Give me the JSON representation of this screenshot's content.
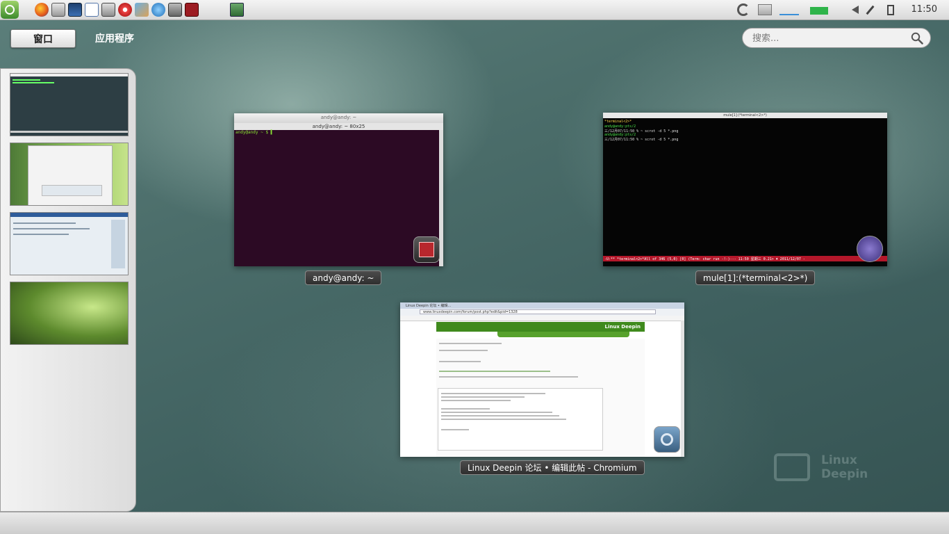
{
  "panel": {
    "time": "11:50",
    "task_icons": [
      "launcher-icon",
      "firefox-icon",
      "file-manager-icon",
      "image-viewer-icon",
      "text-editor-icon",
      "monitor-icon",
      "media-player-icon",
      "paint-icon",
      "deepin-icon",
      "play-icon",
      "red-app-icon"
    ],
    "tray_icons": [
      "sync-icon",
      "keyboard-icon",
      "network-graph-icon",
      "battery-meter-icon",
      "volume-icon",
      "pen-icon",
      "battery-icon"
    ]
  },
  "header": {
    "tab_windows": "窗口",
    "tab_apps": "应用程序",
    "search_placeholder": "搜索..."
  },
  "workspaces": [
    "workspace-1",
    "workspace-2",
    "workspace-3",
    "workspace-4"
  ],
  "windows": {
    "terminal": {
      "label": "andy@andy: ~",
      "title": "andy@andy: ~",
      "menubar": "andy@andy: ~ 80x25",
      "prompt": "andy@andy ~ $ ▌"
    },
    "emacs": {
      "label": "mule[1]:(*terminal<2>*)",
      "title": "mule[1]:(*terminal<2>*)",
      "lines": [
        "*terminal<2>*",
        "andy@andy:pts/2",
        "三/12月07/11:50 % ~ scrot -d 5 *.png",
        "andy@andy:pts/2",
        "三/12月07/11:50 % ~ scrot -d 5 *.png"
      ],
      "modeline": "-U:**  *terminal<2>*All of 346  (5,0)    [0]  (Term: char run -!-)--- 11:50 星期三 0.21> ♦ 2011/12/07 -"
    },
    "chromium": {
      "label": "Linux Deepin 论坛 • 编辑此帖 - Chromium",
      "tab": "Linux Deepin 论坛 • 编辑...",
      "url": "www.linuxdeepin.com/forum/post.php?edit&pid=1328",
      "site_logo": "Linux Deepin"
    }
  },
  "watermark": {
    "line1": "Linux",
    "line2": "Deepin"
  }
}
